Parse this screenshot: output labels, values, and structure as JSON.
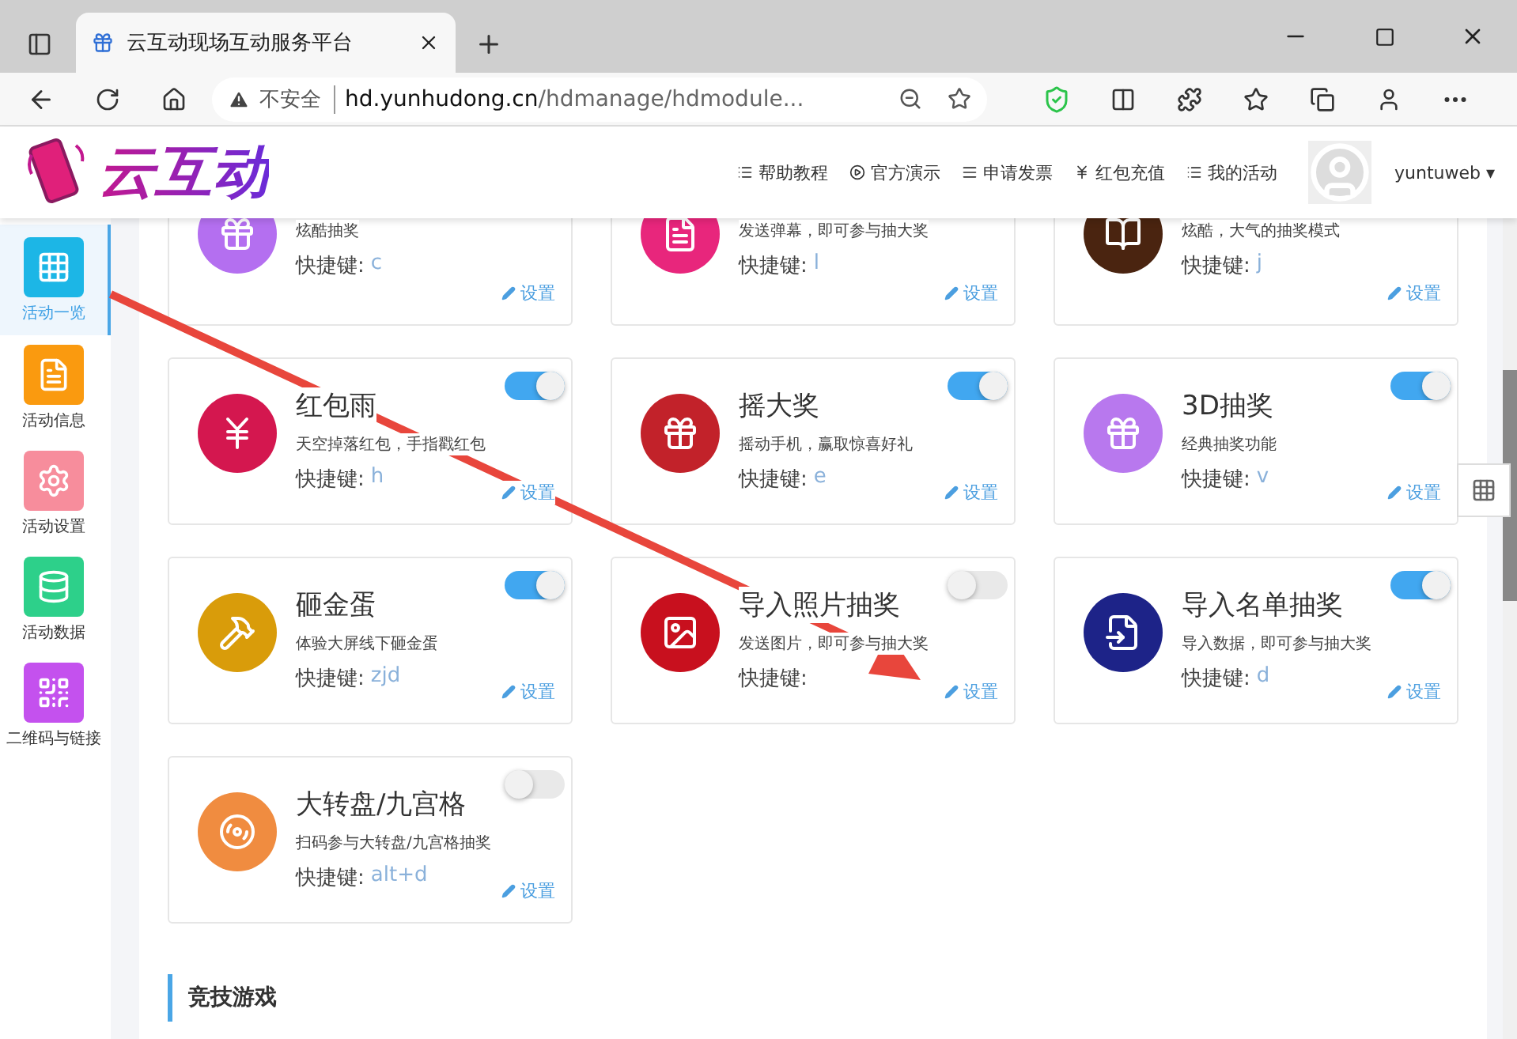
{
  "browser": {
    "tab_title": "云互动现场互动服务平台",
    "address_warning": "不安全",
    "url_host": "hd.yunhudong.cn",
    "url_path": "/hdmanage/hdmodule..."
  },
  "header": {
    "logo": "云互动",
    "nav": [
      {
        "kind": "list",
        "label": "帮助教程"
      },
      {
        "kind": "play",
        "label": "官方演示"
      },
      {
        "kind": "bars",
        "label": "申请发票"
      },
      {
        "kind": "yen",
        "label": "红包充值"
      },
      {
        "kind": "list",
        "label": "我的活动"
      }
    ],
    "username": "yuntuweb",
    "username_caret": "▾"
  },
  "sidebar": {
    "items": [
      {
        "kind": "grid",
        "label": "活动一览",
        "selected": true,
        "color": "#1cb6e6"
      },
      {
        "kind": "doc",
        "label": "活动信息",
        "selected": false,
        "color": "#fa9a0f"
      },
      {
        "kind": "gear",
        "label": "活动设置",
        "selected": false,
        "color": "#f78d9c"
      },
      {
        "kind": "db",
        "label": "活动数据",
        "selected": false,
        "color": "#2dd08a"
      },
      {
        "kind": "qr",
        "label": "二维码与链接",
        "selected": false,
        "color": "#c451ee"
      }
    ]
  },
  "activity_cards": [
    {
      "kind": "gift",
      "color": "#b46ff0",
      "description": "炫酷抽奖",
      "shortcut_label": "快捷键:",
      "shortcut": "c",
      "settings": "设置"
    },
    {
      "kind": "doc",
      "color": "#e8267c",
      "description": "发送弹幕，即可参与抽大奖",
      "shortcut_label": "快捷键:",
      "shortcut": "l",
      "settings": "设置"
    },
    {
      "kind": "book",
      "color": "#4a2410",
      "description": "炫酷，大气的抽奖模式",
      "shortcut_label": "快捷键:",
      "shortcut": "j",
      "settings": "设置"
    },
    {
      "kind": "envelope",
      "color": "#d4174f",
      "title": "红包雨",
      "description": "天空掉落红包，手指戳红包",
      "shortcut_label": "快捷键:",
      "shortcut": "h",
      "settings": "设置",
      "enabled": true
    },
    {
      "kind": "gift",
      "color": "#c2222a",
      "title": "摇大奖",
      "description": "摇动手机，赢取惊喜好礼",
      "shortcut_label": "快捷键:",
      "shortcut": "e",
      "settings": "设置",
      "enabled": true
    },
    {
      "kind": "gift",
      "color": "#b878ee",
      "title": "3D抽奖",
      "description": "经典抽奖功能",
      "shortcut_label": "快捷键:",
      "shortcut": "v",
      "settings": "设置",
      "enabled": true
    },
    {
      "kind": "hammer",
      "color": "#d99c0a",
      "title": "砸金蛋",
      "description": "体验大屏线下砸金蛋",
      "shortcut_label": "快捷键:",
      "shortcut": "zjd",
      "settings": "设置",
      "enabled": true
    },
    {
      "kind": "image",
      "color": "#c8101e",
      "title": "导入照片抽奖",
      "description": "发送图片，即可参与抽大奖",
      "shortcut_label": "快捷键:",
      "settings": "设置",
      "enabled": false
    },
    {
      "kind": "import",
      "color": "#1d2388",
      "title": "导入名单抽奖",
      "description": "导入数据，即可参与抽大奖",
      "shortcut_label": "快捷键:",
      "shortcut": "d",
      "settings": "设置",
      "enabled": true
    },
    {
      "kind": "wheel",
      "color": "#f08c40",
      "title": "大转盘/九宫格",
      "description": "扫码参与大转盘/九宫格抽奖",
      "shortcut_label": "快捷键:",
      "shortcut": "alt+d",
      "settings": "设置",
      "enabled": false
    }
  ],
  "section_heading": "竞技游戏"
}
